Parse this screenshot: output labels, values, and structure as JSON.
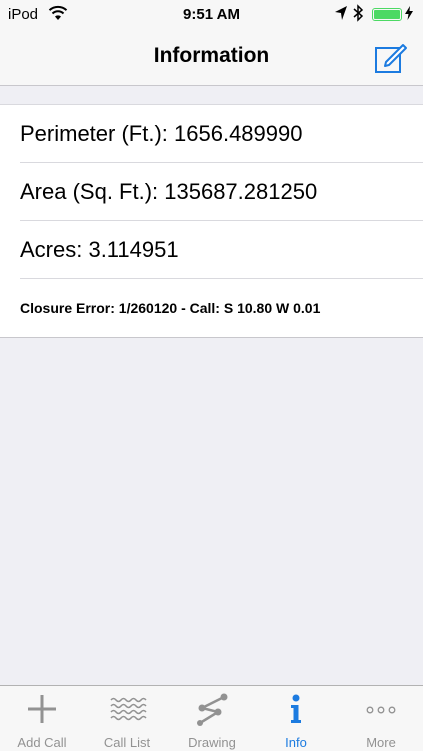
{
  "status_bar": {
    "carrier": "iPod",
    "time": "9:51 AM",
    "battery_level": 1.0
  },
  "nav": {
    "title": "Information",
    "edit_icon": "compose-icon"
  },
  "info_rows": [
    {
      "text": "Perimeter (Ft.): 1656.489990"
    },
    {
      "text": "Area (Sq. Ft.): 135687.281250"
    },
    {
      "text": "Acres: 3.114951"
    },
    {
      "text": "Closure Error: 1/260120 - Call: S 10.80 W 0.01"
    }
  ],
  "tabs": [
    {
      "label": "Add Call",
      "icon": "plus-icon"
    },
    {
      "label": "Call List",
      "icon": "wavy-lines-icon"
    },
    {
      "label": "Drawing",
      "icon": "drawing-icon"
    },
    {
      "label": "Info",
      "icon": "info-icon",
      "active": true
    },
    {
      "label": "More",
      "icon": "more-icon"
    }
  ],
  "colors": {
    "accent": "#1c7be0",
    "inactive": "#929292",
    "battery": "#4cd964"
  }
}
